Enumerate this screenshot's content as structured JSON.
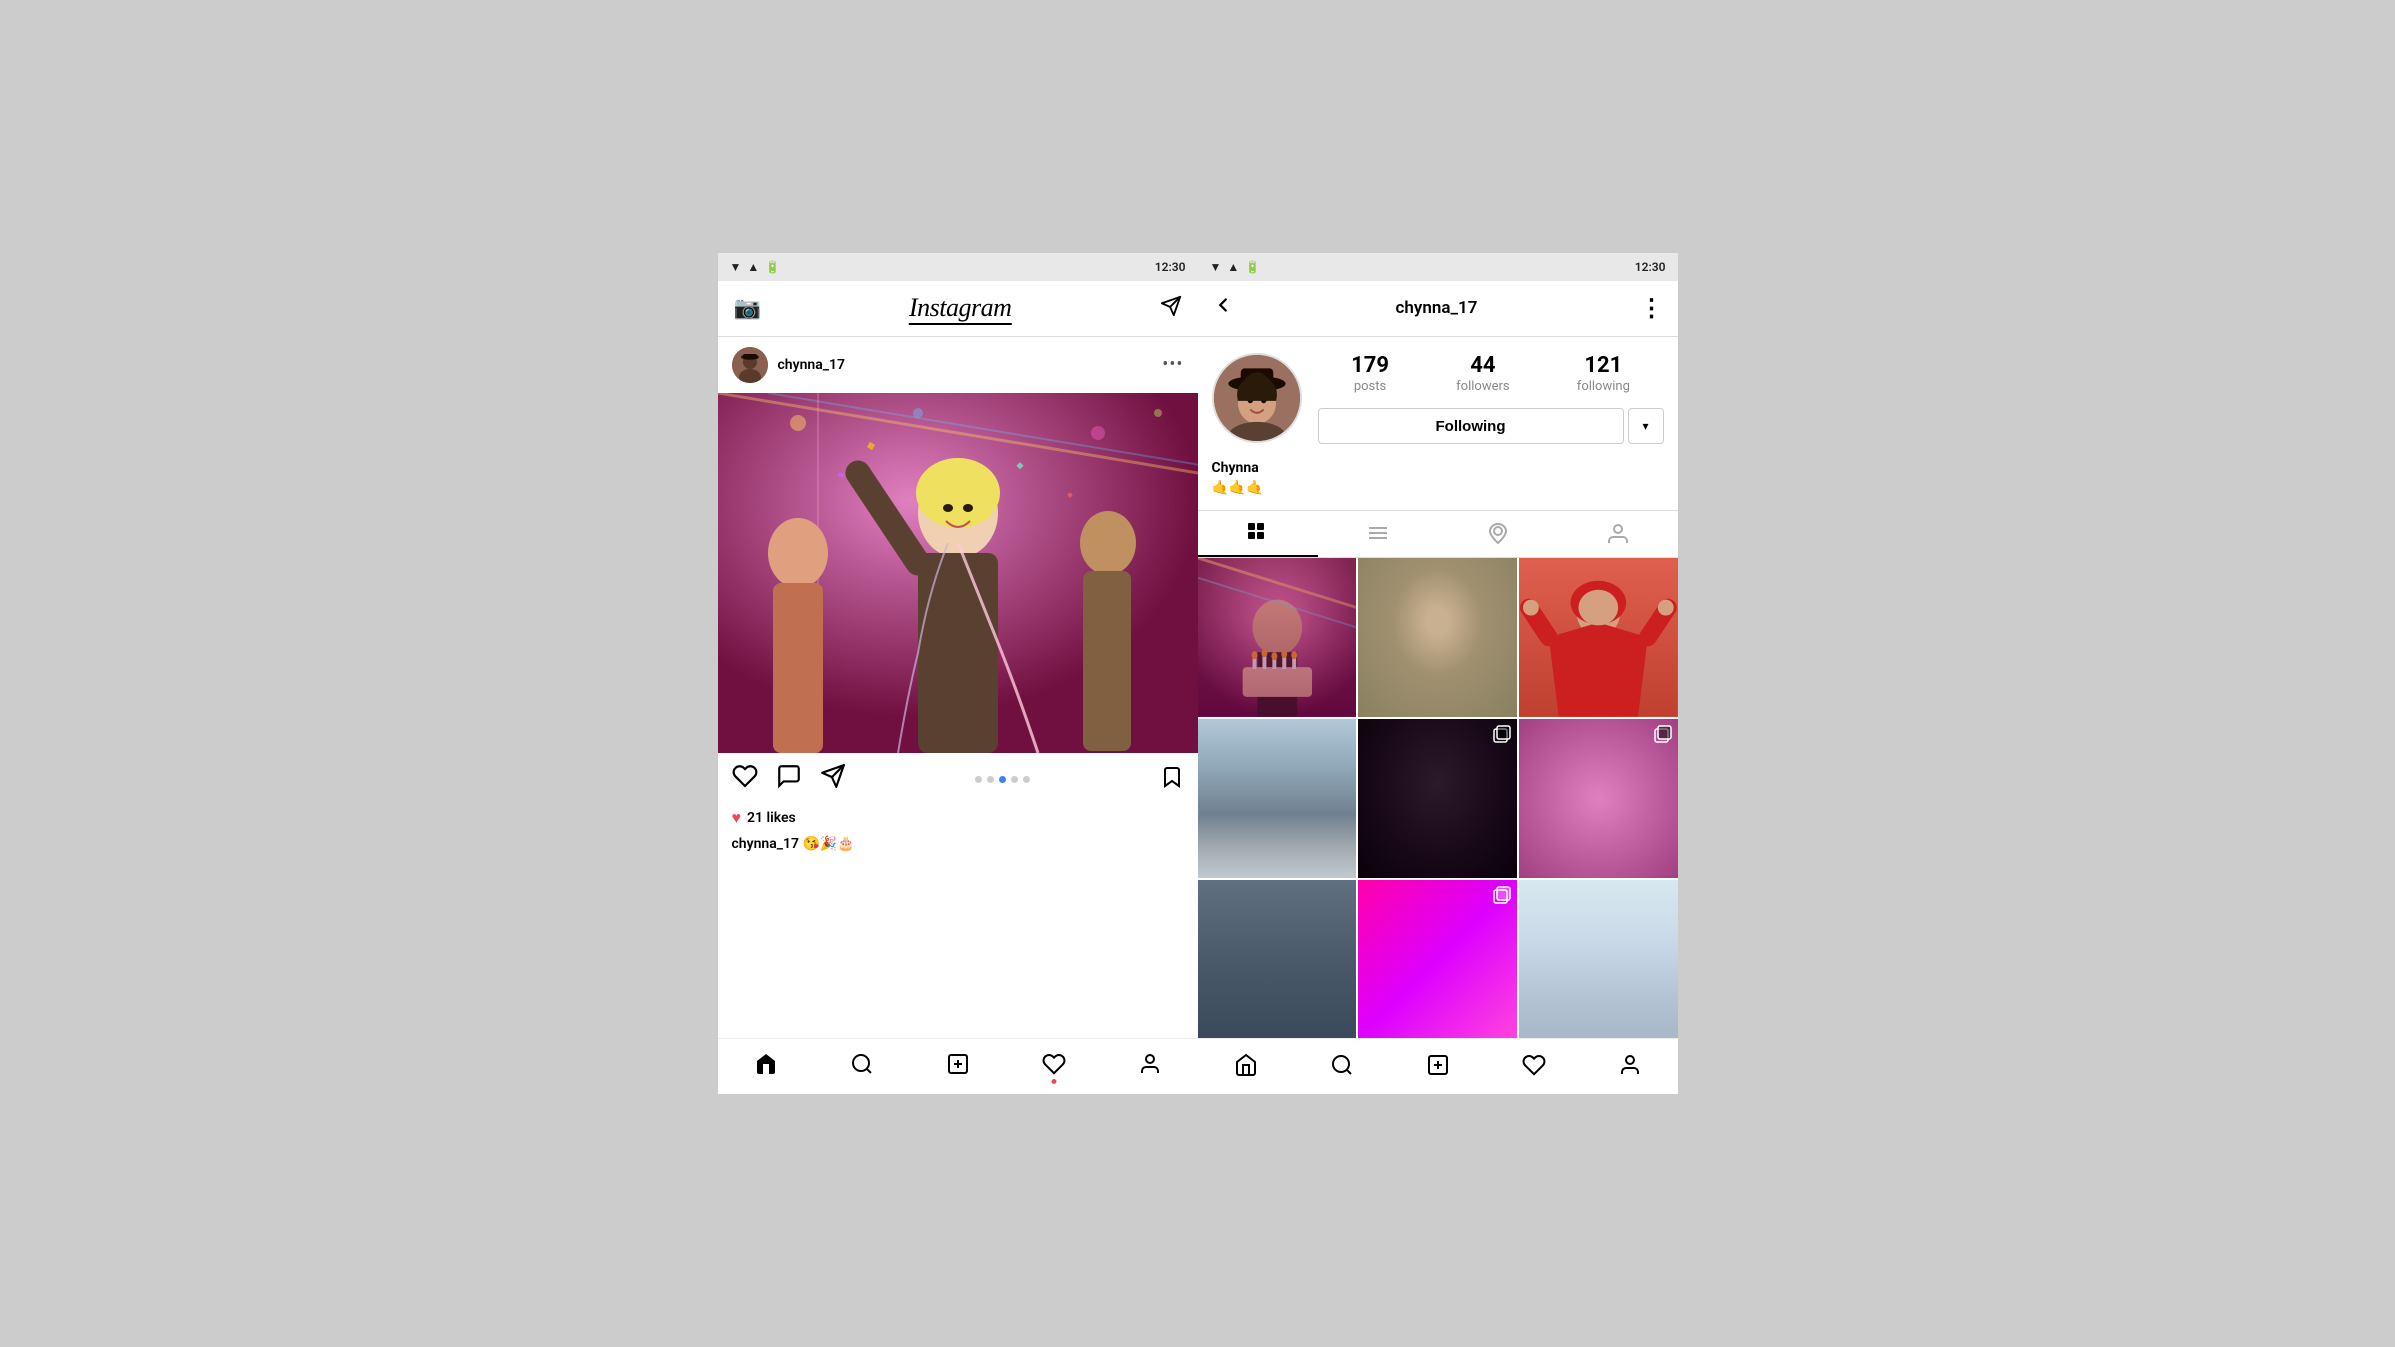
{
  "left_phone": {
    "status_bar": {
      "time": "12:30"
    },
    "nav": {
      "camera_label": "📷",
      "title": "Instagram",
      "send_label": "✉"
    },
    "post": {
      "username": "chynna_17",
      "likes": "21 likes",
      "caption_user": "chynna_17",
      "caption_emojis": " 😘🎉🎂",
      "dots_more": "⋯"
    },
    "bottom_nav": {
      "home": "⌂",
      "search": "🔍",
      "add": "+",
      "heart": "♥",
      "profile": "👤"
    }
  },
  "right_phone": {
    "status_bar": {
      "time": "12:30"
    },
    "nav": {
      "back": "←",
      "username": "chynna_17",
      "menu": "⋮"
    },
    "profile": {
      "display_name": "Chynna",
      "bio_emoji": "🤙🤙🤙",
      "stats": {
        "posts_count": "179",
        "posts_label": "posts",
        "followers_count": "44",
        "followers_label": "followers",
        "following_count": "121",
        "following_label": "following"
      },
      "follow_button": "Following",
      "dropdown_icon": "▾"
    },
    "tabs": {
      "grid": "⊞",
      "list": "≡",
      "location": "📍",
      "tag": "👤"
    },
    "bottom_nav": {
      "home": "⌂",
      "search": "🔍",
      "add": "+",
      "heart": "♥",
      "profile": "👤"
    }
  }
}
